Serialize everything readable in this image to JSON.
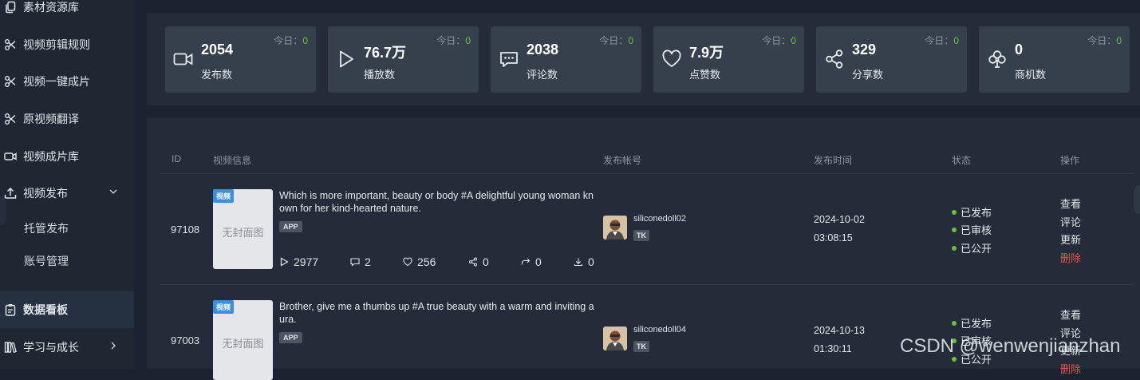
{
  "sidebar": {
    "items": [
      {
        "label": "素材资源库",
        "icon": "copy-icon"
      },
      {
        "label": "视频剪辑规则",
        "icon": "scissors-icon"
      },
      {
        "label": "视频一键成片",
        "icon": "scissors-icon"
      },
      {
        "label": "原视频翻译",
        "icon": "scissors-icon"
      },
      {
        "label": "视频成片库",
        "icon": "video-camera-icon"
      },
      {
        "label": "视频发布",
        "icon": "upload-icon"
      },
      {
        "label": "托管发布"
      },
      {
        "label": "账号管理"
      },
      {
        "label": "数据看板",
        "icon": "clipboard-icon"
      },
      {
        "label": "学习与成长",
        "icon": "books-icon"
      }
    ]
  },
  "stats": [
    {
      "value": "2054",
      "label": "发布数",
      "today_label": "今日：",
      "today_value": "0",
      "icon": "video-camera-icon"
    },
    {
      "value": "76.7万",
      "label": "播放数",
      "today_label": "今日：",
      "today_value": "0",
      "icon": "play-icon"
    },
    {
      "value": "2038",
      "label": "评论数",
      "today_label": "今日：",
      "today_value": "0",
      "icon": "comment-icon"
    },
    {
      "value": "7.9万",
      "label": "点赞数",
      "today_label": "今日：",
      "today_value": "0",
      "icon": "heart-icon"
    },
    {
      "value": "329",
      "label": "分享数",
      "today_label": "今日：",
      "today_value": "0",
      "icon": "share-icon"
    },
    {
      "value": "0",
      "label": "商机数",
      "today_label": "今日：",
      "today_value": "0",
      "icon": "clover-icon"
    }
  ],
  "table": {
    "headers": {
      "id": "ID",
      "info": "视频信息",
      "account": "发布帐号",
      "time": "发布时间",
      "status": "状态",
      "ops": "操作"
    },
    "rows": [
      {
        "id": "97108",
        "tag": "视频",
        "no_cover": "无封面图",
        "title": "Which is more important, beauty or body #A delightful young woman known for her kind-hearted nature.",
        "source": "APP",
        "plays": "2977",
        "comments": "2",
        "likes": "256",
        "shares": "0",
        "forwards": "0",
        "downloads": "0",
        "account": "siliconedoll02",
        "platform": "TK",
        "date": "2024-10-02",
        "time": "03:08:15",
        "status": [
          "已发布",
          "已审核",
          "已公开"
        ],
        "ops": [
          "查看",
          "评论",
          "更新",
          "删除"
        ]
      },
      {
        "id": "97003",
        "tag": "视频",
        "no_cover": "无封面图",
        "title": "Brother, give me a thumbs up #A true beauty with a warm and inviting aura.",
        "source": "APP",
        "account": "siliconedoll04",
        "platform": "TK",
        "date": "2024-10-13",
        "time": "01:30:11",
        "status": [
          "已发布",
          "已审核",
          "已公开"
        ],
        "ops": [
          "查看",
          "评论",
          "更新",
          "删除"
        ]
      }
    ]
  },
  "watermark": "CSDN @wenwenjianzhan",
  "colors": {
    "success": "#67c23a",
    "danger": "#e0574b",
    "tag_blue": "#3a8ee6"
  }
}
